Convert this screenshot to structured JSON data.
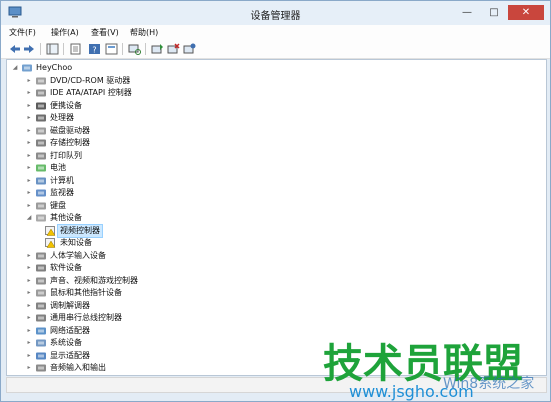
{
  "window": {
    "title": "设备管理器"
  },
  "menu": [
    "文件(F)",
    "操作(A)",
    "查看(V)",
    "帮助(H)"
  ],
  "tree": {
    "root": "HeyChoo",
    "items": [
      {
        "label": "DVD/CD-ROM 驱动器",
        "icon": "disc-drive-icon"
      },
      {
        "label": "IDE ATA/ATAPI 控制器",
        "icon": "ide-controller-icon"
      },
      {
        "label": "便携设备",
        "icon": "portable-device-icon"
      },
      {
        "label": "处理器",
        "icon": "processor-icon"
      },
      {
        "label": "磁盘驱动器",
        "icon": "disk-drive-icon"
      },
      {
        "label": "存储控制器",
        "icon": "storage-controller-icon"
      },
      {
        "label": "打印队列",
        "icon": "printer-icon"
      },
      {
        "label": "电池",
        "icon": "battery-icon"
      },
      {
        "label": "计算机",
        "icon": "computer-icon"
      },
      {
        "label": "监视器",
        "icon": "monitor-icon"
      },
      {
        "label": "键盘",
        "icon": "keyboard-icon"
      },
      {
        "label": "其他设备",
        "icon": "other-devices-icon",
        "expanded": true,
        "children": [
          {
            "label": "视频控制器",
            "icon": "warning-device-icon",
            "selected": true
          },
          {
            "label": "未知设备",
            "icon": "warning-device-icon"
          }
        ]
      },
      {
        "label": "人体学输入设备",
        "icon": "hid-icon"
      },
      {
        "label": "软件设备",
        "icon": "software-device-icon"
      },
      {
        "label": "声音、视频和游戏控制器",
        "icon": "sound-icon"
      },
      {
        "label": "鼠标和其他指针设备",
        "icon": "mouse-icon"
      },
      {
        "label": "调制解调器",
        "icon": "modem-icon"
      },
      {
        "label": "通用串行总线控制器",
        "icon": "usb-icon"
      },
      {
        "label": "网络适配器",
        "icon": "network-adapter-icon"
      },
      {
        "label": "系统设备",
        "icon": "system-device-icon"
      },
      {
        "label": "显示适配器",
        "icon": "display-adapter-icon"
      },
      {
        "label": "音频输入和输出",
        "icon": "audio-io-icon"
      }
    ]
  },
  "watermark": {
    "title": "技术员联盟",
    "url": "www.jsgho.com",
    "overlay": "Win8系统之家"
  },
  "colors": {
    "accent": "#1e8fd6",
    "close": "#c9463d",
    "selection": "#cce8ff"
  }
}
